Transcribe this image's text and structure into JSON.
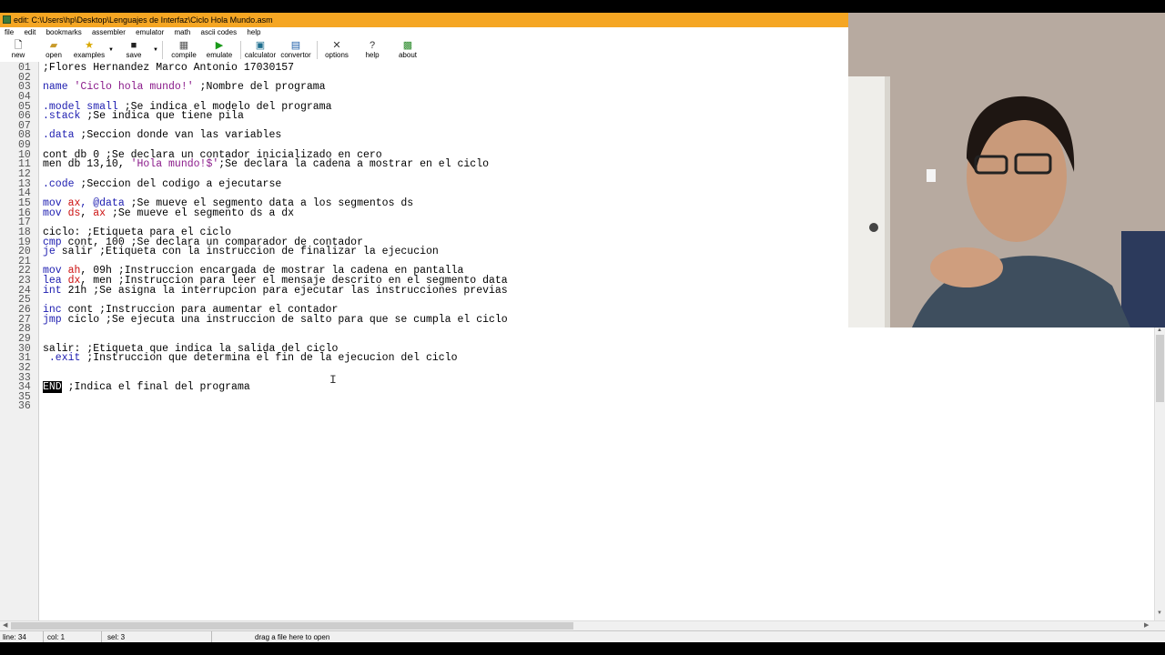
{
  "window": {
    "title": "edit: C:\\Users\\hp\\Desktop\\Lenguajes de Interfaz\\Ciclo Hola Mundo.asm"
  },
  "menu": [
    "file",
    "edit",
    "bookmarks",
    "assembler",
    "emulator",
    "math",
    "ascii codes",
    "help"
  ],
  "toolbar": {
    "new": "new",
    "open": "open",
    "examples": "examples",
    "save": "save",
    "compile": "compile",
    "emulate": "emulate",
    "calculator": "calculator",
    "convertor": "convertor",
    "options": "options",
    "help": "help",
    "about": "about"
  },
  "code_lines": [
    {
      "n": "01",
      "parts": [
        {
          "t": ";Flores Hernandez Marco Antonio 17030157",
          "c": "c"
        }
      ]
    },
    {
      "n": "02",
      "parts": []
    },
    {
      "n": "03",
      "parts": [
        {
          "t": "name ",
          "c": "k"
        },
        {
          "t": "'Ciclo hola mundo!'",
          "c": "s"
        },
        {
          "t": " ;Nombre del programa",
          "c": "c"
        }
      ]
    },
    {
      "n": "04",
      "parts": []
    },
    {
      "n": "05",
      "parts": [
        {
          "t": ".model small",
          "c": "k"
        },
        {
          "t": " ;Se indica el modelo del programa",
          "c": "c"
        }
      ]
    },
    {
      "n": "06",
      "parts": [
        {
          "t": ".stack",
          "c": "k"
        },
        {
          "t": " ;Se indica que tiene pila",
          "c": "c"
        }
      ]
    },
    {
      "n": "07",
      "parts": []
    },
    {
      "n": "08",
      "parts": [
        {
          "t": ".data",
          "c": "k"
        },
        {
          "t": " ;Seccion donde van las variables",
          "c": "c"
        }
      ]
    },
    {
      "n": "09",
      "parts": []
    },
    {
      "n": "10",
      "parts": [
        {
          "t": "cont db 0",
          "c": "c"
        },
        {
          "t": " ;Se declara un contador inicializado en cero",
          "c": "c"
        }
      ]
    },
    {
      "n": "11",
      "parts": [
        {
          "t": "men db 13,10, ",
          "c": "c"
        },
        {
          "t": "'Hola mundo!$'",
          "c": "s"
        },
        {
          "t": ";Se declara la cadena a mostrar en el ciclo",
          "c": "c"
        }
      ]
    },
    {
      "n": "12",
      "parts": []
    },
    {
      "n": "13",
      "parts": [
        {
          "t": ".code",
          "c": "k"
        },
        {
          "t": " ;Seccion del codigo a ejecutarse",
          "c": "c"
        }
      ]
    },
    {
      "n": "14",
      "parts": []
    },
    {
      "n": "15",
      "parts": [
        {
          "t": "mov ",
          "c": "k"
        },
        {
          "t": "ax",
          "c": "r"
        },
        {
          "t": ", @data",
          "c": "k"
        },
        {
          "t": " ;Se mueve el segmento data a los segmentos ds",
          "c": "c"
        }
      ]
    },
    {
      "n": "16",
      "parts": [
        {
          "t": "mov ",
          "c": "k"
        },
        {
          "t": "ds",
          "c": "r"
        },
        {
          "t": ", ",
          "c": "c"
        },
        {
          "t": "ax",
          "c": "r"
        },
        {
          "t": " ;Se mueve el segmento ds a dx",
          "c": "c"
        }
      ]
    },
    {
      "n": "17",
      "parts": []
    },
    {
      "n": "18",
      "parts": [
        {
          "t": "ciclo:",
          "c": "c"
        },
        {
          "t": " ;Etiqueta para el ciclo",
          "c": "c"
        }
      ]
    },
    {
      "n": "19",
      "parts": [
        {
          "t": "cmp ",
          "c": "k"
        },
        {
          "t": "cont, 100",
          "c": "c"
        },
        {
          "t": " ;Se declara un comparador de contador",
          "c": "c"
        }
      ]
    },
    {
      "n": "20",
      "parts": [
        {
          "t": "je ",
          "c": "k"
        },
        {
          "t": "salir",
          "c": "c"
        },
        {
          "t": " ;Etiqueta con la instruccion de finalizar la ejecucion",
          "c": "c"
        }
      ]
    },
    {
      "n": "21",
      "parts": []
    },
    {
      "n": "22",
      "parts": [
        {
          "t": "mov ",
          "c": "k"
        },
        {
          "t": "ah",
          "c": "r"
        },
        {
          "t": ", 09h",
          "c": "c"
        },
        {
          "t": " ;Instruccion encargada de mostrar la cadena en pantalla",
          "c": "c"
        }
      ]
    },
    {
      "n": "23",
      "parts": [
        {
          "t": "lea ",
          "c": "k"
        },
        {
          "t": "dx",
          "c": "r"
        },
        {
          "t": ", men",
          "c": "c"
        },
        {
          "t": " ;Instruccion para leer el mensaje descrito en el segmento data",
          "c": "c"
        }
      ]
    },
    {
      "n": "24",
      "parts": [
        {
          "t": "int ",
          "c": "k"
        },
        {
          "t": "21h",
          "c": "c"
        },
        {
          "t": " ;Se asigna la interrupcion para ejecutar las instrucciones previas",
          "c": "c"
        }
      ]
    },
    {
      "n": "25",
      "parts": []
    },
    {
      "n": "26",
      "parts": [
        {
          "t": "inc ",
          "c": "k"
        },
        {
          "t": "cont",
          "c": "c"
        },
        {
          "t": " ;Instruccion para aumentar el contador",
          "c": "c"
        }
      ]
    },
    {
      "n": "27",
      "parts": [
        {
          "t": "jmp ",
          "c": "k"
        },
        {
          "t": "ciclo",
          "c": "c"
        },
        {
          "t": " ;Se ejecuta una instruccion de salto para que se cumpla el ciclo",
          "c": "c"
        }
      ]
    },
    {
      "n": "28",
      "parts": []
    },
    {
      "n": "29",
      "parts": []
    },
    {
      "n": "30",
      "parts": [
        {
          "t": "salir:",
          "c": "c"
        },
        {
          "t": " ;Etiqueta que indica la salida del ciclo",
          "c": "c"
        }
      ]
    },
    {
      "n": "31",
      "parts": [
        {
          "t": " .exit",
          "c": "k"
        },
        {
          "t": " ;Instruccion que determina el fin de la ejecucion del ciclo",
          "c": "c"
        }
      ]
    },
    {
      "n": "32",
      "parts": []
    },
    {
      "n": "33",
      "parts": []
    },
    {
      "n": "34",
      "parts": [
        {
          "t": "END",
          "c": "endtok"
        },
        {
          "t": " ;Indica el final del programa",
          "c": "c"
        }
      ]
    },
    {
      "n": "35",
      "parts": []
    },
    {
      "n": "36",
      "parts": []
    }
  ],
  "status": {
    "line": "line: 34",
    "col": "col: 1",
    "sel": "sel: 3",
    "hint": "drag a file here to open"
  },
  "colors": {
    "titlebar": "#f5a623",
    "keyword": "#1c1cb0",
    "string": "#8a1a8a",
    "register": "#cc1111"
  }
}
